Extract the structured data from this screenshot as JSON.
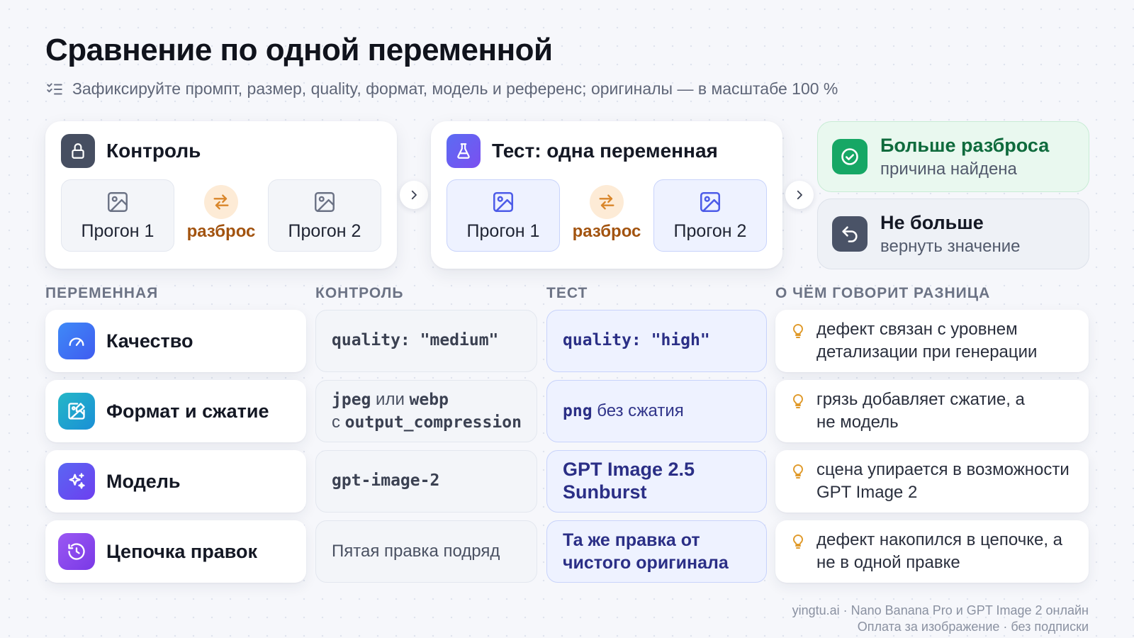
{
  "title": "Сравнение по одной переменной",
  "subtitle": "Зафиксируйте промпт, размер, quality, формат, модель и референс; оригиналы — в масштабе 100 %",
  "control_card": {
    "title": "Контроль",
    "run1": "Прогон 1",
    "spread": "разброс",
    "run2": "Прогон 2"
  },
  "test_card": {
    "title": "Тест: одна переменная",
    "run1": "Прогон 1",
    "spread": "разброс",
    "run2": "Прогон 2"
  },
  "results": {
    "more": {
      "title": "Больше разброса",
      "sub": "причина найдена"
    },
    "not_more": {
      "title": "Не больше",
      "sub": "вернуть значение"
    }
  },
  "columns": {
    "variable": "ПЕРЕМЕННАЯ",
    "control": "КОНТРОЛЬ",
    "test": "ТЕСТ",
    "meaning": "О ЧЁМ ГОВОРИТ РАЗНИЦА"
  },
  "rows": [
    {
      "variable": "Качество",
      "icon": "gauge-icon",
      "control_code": "quality: \"medium\"",
      "test_code": "quality: \"high\"",
      "note": "дефект связан с уровнем детализации при генерации"
    },
    {
      "variable": "Формат и сжатие",
      "icon": "image-edit-icon",
      "control_a": "jpeg",
      "control_or": " или ",
      "control_b": "webp",
      "control_with": "с ",
      "control_c": "output_compression",
      "test_code": "png",
      "test_text": " без сжатия",
      "note": "грязь добавляет сжатие, а не модель"
    },
    {
      "variable": "Модель",
      "icon": "sparkles-icon",
      "control_code": "gpt-image-2",
      "test_text": "GPT Image 2.5 Sunburst",
      "note": "сцена упирается в возможности GPT Image 2"
    },
    {
      "variable": "Цепочка правок",
      "icon": "history-icon",
      "control_text": "Пятая правка подряд",
      "test_text": "Та же правка от чистого оригинала",
      "note": "дефект накопился в цепочке, а не в одной правке"
    }
  ],
  "footer": {
    "line1": "yingtu.ai · Nano Banana Pro и GPT Image 2 онлайн",
    "line2": "Оплата за изображение · без подписки"
  },
  "colors": {
    "accent_blue": "#3b6cf6",
    "spread_orange": "#a2530f",
    "success_green": "#16a765",
    "test_fill": "#eef2ff"
  }
}
